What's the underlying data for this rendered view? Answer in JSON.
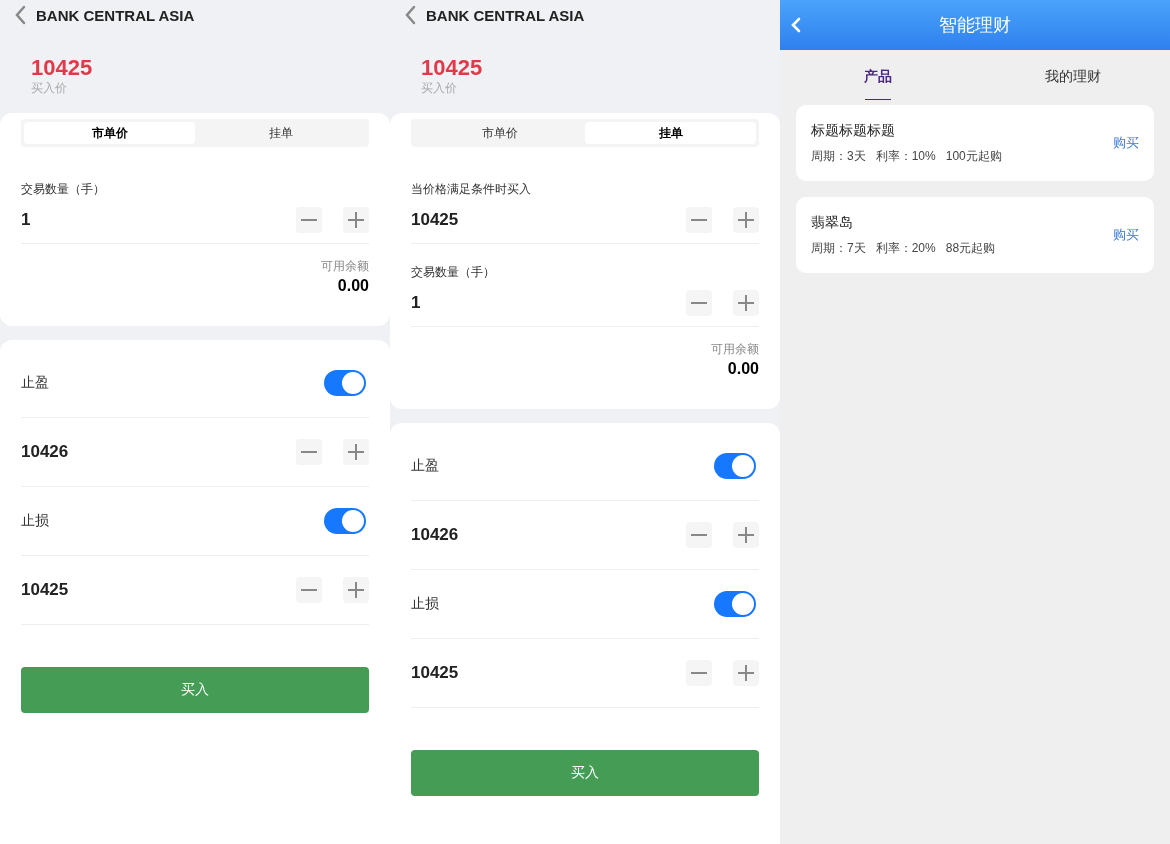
{
  "trade_screens": [
    {
      "title": "BANK CENTRAL ASIA",
      "price": "10425",
      "price_label": "买入价",
      "order_tabs": [
        {
          "label": "市单价",
          "selected": true
        },
        {
          "label": "挂单",
          "selected": false
        }
      ],
      "fields": [
        {
          "label": "交易数量（手）",
          "value": "1"
        }
      ],
      "balance_label": "可用余额",
      "balance": "0.00",
      "settings": [
        {
          "kind": "toggle",
          "label": "止盈",
          "on": true
        },
        {
          "kind": "stepper",
          "value": "10426"
        },
        {
          "kind": "toggle",
          "label": "止损",
          "on": true
        },
        {
          "kind": "stepper",
          "value": "10425"
        }
      ],
      "buy_button": "买入"
    },
    {
      "title": "BANK CENTRAL ASIA",
      "price": "10425",
      "price_label": "买入价",
      "order_tabs": [
        {
          "label": "市单价",
          "selected": false
        },
        {
          "label": "挂单",
          "selected": true
        }
      ],
      "fields": [
        {
          "label": "当价格满足条件时买入",
          "value": "10425"
        },
        {
          "label": "交易数量（手）",
          "value": "1"
        }
      ],
      "balance_label": "可用余额",
      "balance": "0.00",
      "settings": [
        {
          "kind": "toggle",
          "label": "止盈",
          "on": true
        },
        {
          "kind": "stepper",
          "value": "10426"
        },
        {
          "kind": "toggle",
          "label": "止损",
          "on": true
        },
        {
          "kind": "stepper",
          "value": "10425"
        }
      ],
      "buy_button": "买入"
    }
  ],
  "finance_screen": {
    "title": "智能理财",
    "tabs": [
      {
        "label": "产品",
        "selected": true
      },
      {
        "label": "我的理财",
        "selected": false
      }
    ],
    "products": [
      {
        "name": "标题标题标题",
        "details": [
          "周期：3天",
          "利率：10%",
          "100元起购"
        ],
        "buy": "购买"
      },
      {
        "name": "翡翠岛",
        "details": [
          "周期：7天",
          "利率：20%",
          "88元起购"
        ],
        "buy": "购买"
      }
    ]
  }
}
